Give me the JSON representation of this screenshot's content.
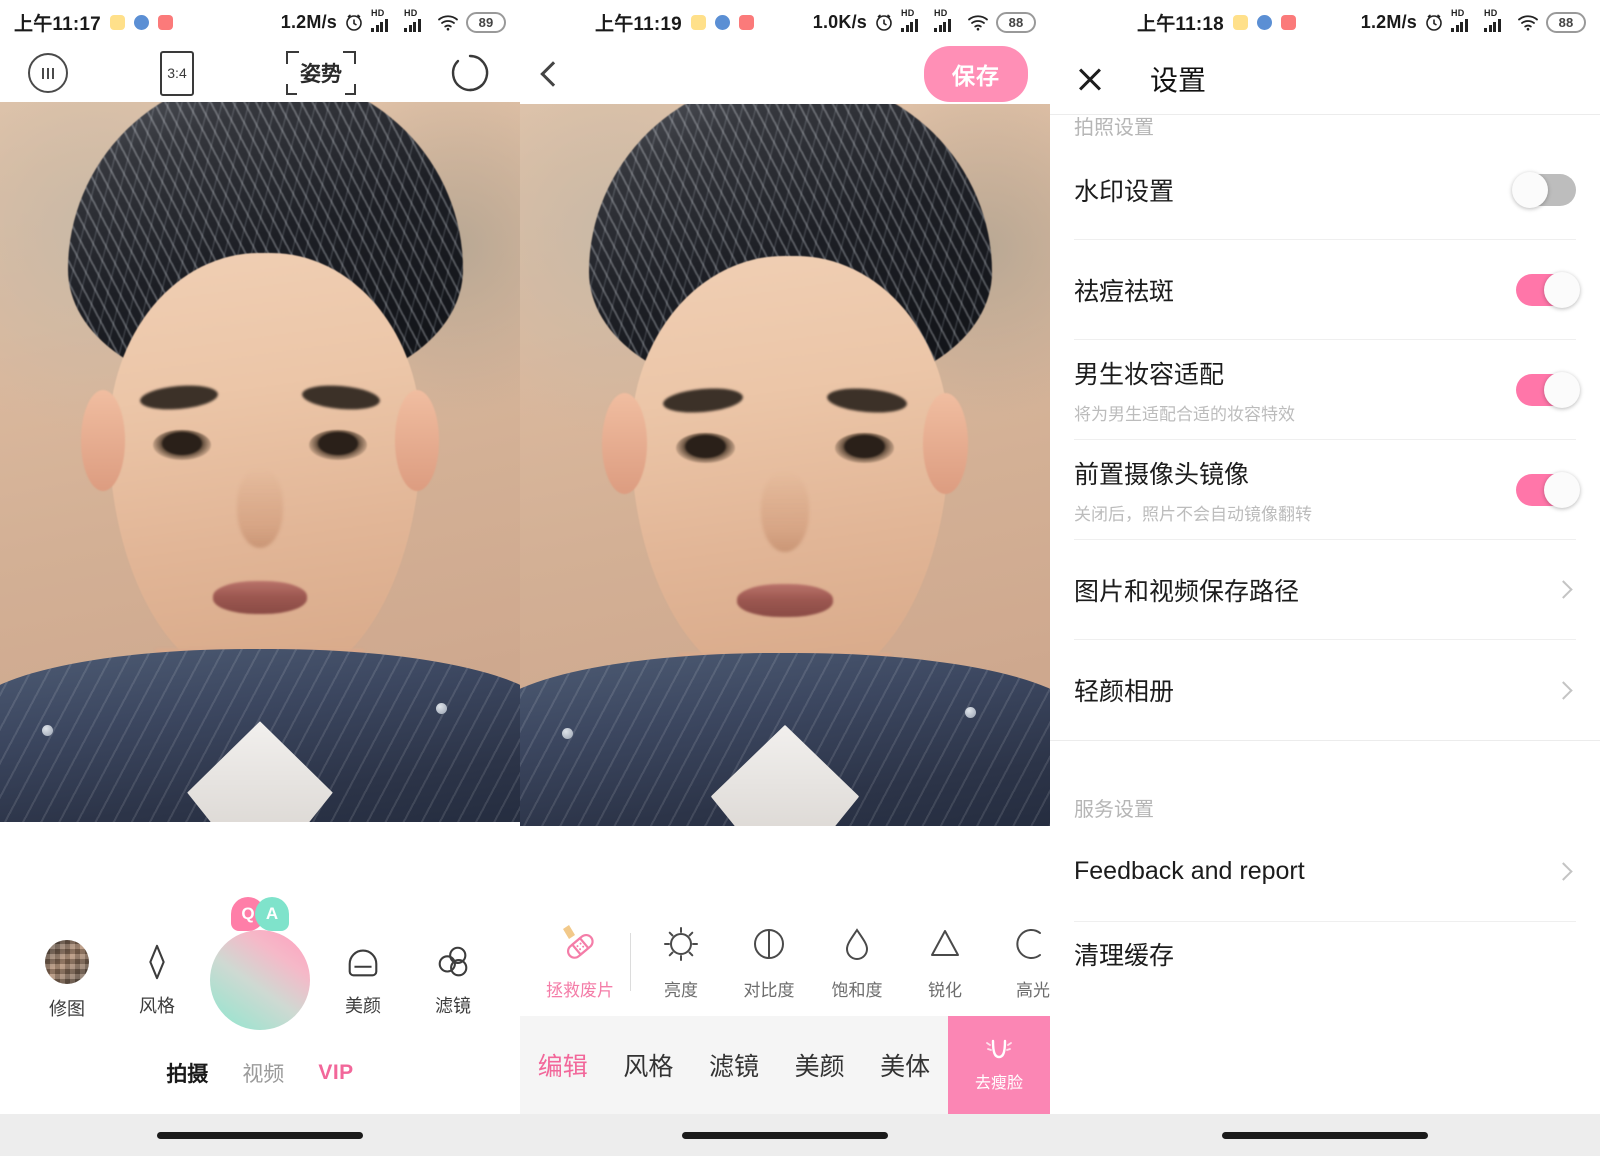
{
  "panel_camera": {
    "status_bar": {
      "time": "上午11:17",
      "net_speed": "1.2M/s",
      "battery": "89",
      "hd_label": "HD",
      "icons": [
        "app-chip-yellow",
        "app-chip-blue",
        "app-chip-red",
        "alarm-icon",
        "signal-icon",
        "signal-icon",
        "wifi-icon",
        "battery-icon"
      ]
    },
    "topbar": {
      "settings_label": "",
      "ratio_label": "3:4",
      "pose_label": "姿势",
      "flip_label": ""
    },
    "qa_badge": {
      "q": "Q",
      "a": "A"
    },
    "controls": [
      {
        "label": "修图",
        "icon": "photo-thumbnail-icon"
      },
      {
        "label": "风格",
        "icon": "sparkle-icon"
      },
      {
        "label": "美颜",
        "icon": "face-beauty-icon"
      },
      {
        "label": "滤镜",
        "icon": "filter-circles-icon"
      }
    ],
    "tabs": [
      {
        "label": "拍摄",
        "state": "active"
      },
      {
        "label": "视频",
        "state": "inactive"
      },
      {
        "label": "VIP",
        "state": "vip"
      }
    ]
  },
  "panel_editor": {
    "status_bar": {
      "time": "上午11:19",
      "net_speed": "1.0K/s",
      "battery": "88",
      "hd_label": "HD"
    },
    "topbar": {
      "back_label": "",
      "save_label": "保存"
    },
    "tools": [
      {
        "label": "拯救废片",
        "icon": "bandage-icon",
        "vip": true
      },
      {
        "label": "亮度",
        "icon": "brightness-sun-icon",
        "vip": false
      },
      {
        "label": "对比度",
        "icon": "contrast-circle-icon",
        "vip": false
      },
      {
        "label": "饱和度",
        "icon": "saturation-droplet-icon",
        "vip": false
      },
      {
        "label": "锐化",
        "icon": "sharpen-triangle-icon",
        "vip": false
      },
      {
        "label": "高光",
        "icon": "highlight-arc-icon",
        "vip": false
      }
    ],
    "tabs": [
      {
        "label": "编辑",
        "state": "active"
      },
      {
        "label": "风格",
        "state": "inactive"
      },
      {
        "label": "滤镜",
        "state": "inactive"
      },
      {
        "label": "美颜",
        "state": "inactive"
      },
      {
        "label": "美体",
        "state": "inactive"
      }
    ],
    "slimface": {
      "label": "去瘦脸",
      "icon": "slim-face-icon",
      "color": "#FB86B4"
    }
  },
  "panel_settings": {
    "status_bar": {
      "time": "上午11:18",
      "net_speed": "1.2M/s",
      "battery": "88",
      "hd_label": "HD"
    },
    "topbar": {
      "close_label": "",
      "title": "设置"
    },
    "groups": [
      {
        "title": "拍照设置",
        "rows": [
          {
            "title": "水印设置",
            "sub": "",
            "control": "toggle",
            "state": "off"
          },
          {
            "title": "祛痘祛斑",
            "sub": "",
            "control": "toggle",
            "state": "on"
          },
          {
            "title": "男生妆容适配",
            "sub": "将为男生适配合适的妆容特效",
            "control": "toggle",
            "state": "on"
          },
          {
            "title": "前置摄像头镜像",
            "sub": "关闭后，照片不会自动镜像翻转",
            "control": "toggle",
            "state": "on"
          },
          {
            "title": "图片和视频保存路径",
            "sub": "",
            "control": "chevron",
            "state": ""
          },
          {
            "title": "轻颜相册",
            "sub": "",
            "control": "chevron",
            "state": ""
          }
        ]
      },
      {
        "title": "服务设置",
        "rows": [
          {
            "title": "Feedback and report",
            "sub": "",
            "control": "chevron",
            "state": ""
          },
          {
            "title": "清理缓存",
            "sub": "",
            "control": "chevron",
            "state": ""
          }
        ]
      }
    ]
  },
  "colors": {
    "accent_pink": "#FF76A9",
    "save_pink": "#FF8FB6",
    "vip_pink": "#F2679A",
    "mint": "#7FE3CB",
    "toggle_off": "#BDBDBD"
  }
}
